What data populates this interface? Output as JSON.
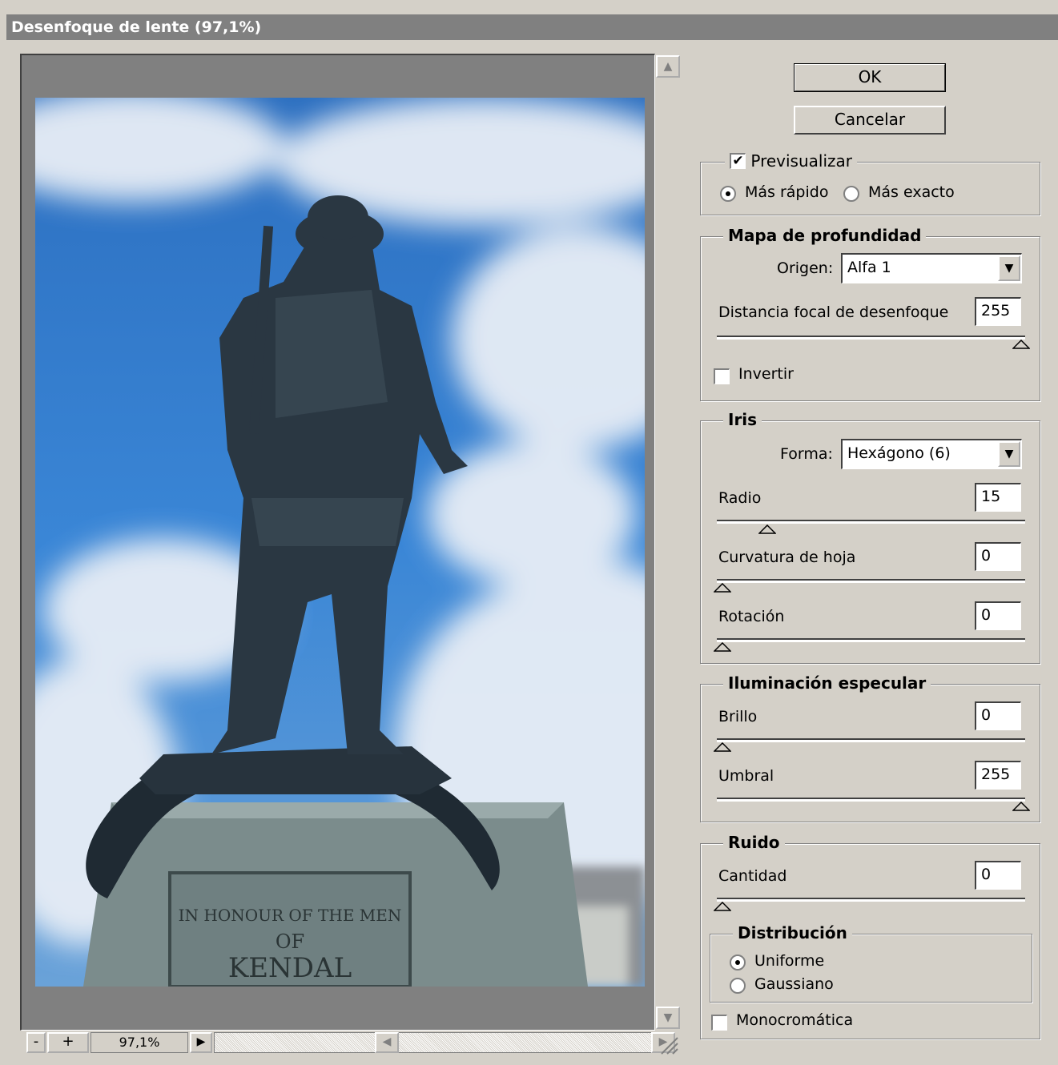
{
  "window": {
    "title": "Desenfoque de lente (97,1%)"
  },
  "preview": {
    "zoom_minus": "-",
    "zoom_plus": "+",
    "zoom_level": "97,1%",
    "zoom_menu_glyph": "▶",
    "inscription": [
      "IN HONOUR OF THE MEN",
      "OF",
      "KENDAL"
    ]
  },
  "buttons": {
    "ok": "OK",
    "cancel": "Cancelar"
  },
  "preview_group": {
    "checkbox_label": "Previsualizar",
    "checked": true,
    "fast_label": "Más rápido",
    "accurate_label": "Más exacto",
    "selected": "fast"
  },
  "depth_map": {
    "title": "Mapa de profundidad",
    "source_label": "Origen:",
    "source_value": "Alfa 1",
    "focal_label": "Distancia focal de desenfoque",
    "focal_value": "255",
    "focal_slider": 1.0,
    "invert_label": "Invertir",
    "invert_checked": false
  },
  "iris": {
    "title": "Iris",
    "shape_label": "Forma:",
    "shape_value": "Hexágono (6)",
    "radius_label": "Radio",
    "radius_value": "15",
    "radius_slider": 0.15,
    "curvature_label": "Curvatura de hoja",
    "curvature_value": "0",
    "curvature_slider": 0,
    "rotation_label": "Rotación",
    "rotation_value": "0",
    "rotation_slider": 0
  },
  "specular": {
    "title": "Iluminación especular",
    "brightness_label": "Brillo",
    "brightness_value": "0",
    "brightness_slider": 0,
    "threshold_label": "Umbral",
    "threshold_value": "255",
    "threshold_slider": 1.0
  },
  "noise": {
    "title": "Ruido",
    "amount_label": "Cantidad",
    "amount_value": "0",
    "amount_slider": 0,
    "distribution_title": "Distribución",
    "uniform_label": "Uniforme",
    "gaussian_label": "Gaussiano",
    "selected": "uniform",
    "mono_label": "Monocromática",
    "mono_checked": false
  }
}
